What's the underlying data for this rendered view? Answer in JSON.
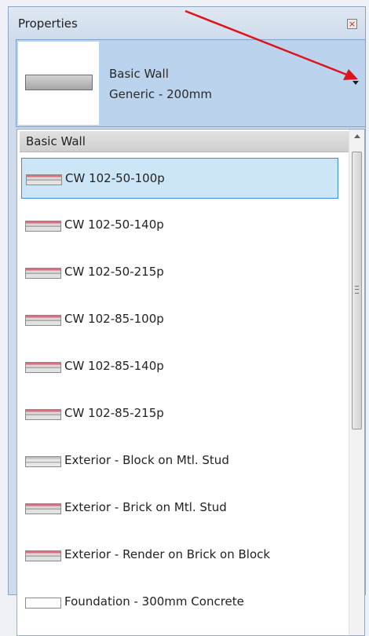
{
  "panel": {
    "title": "Properties"
  },
  "type_selector": {
    "family": "Basic Wall",
    "type": "Generic - 200mm"
  },
  "list": {
    "group_header": "Basic Wall",
    "items": [
      {
        "label": "CW 102-50-100p",
        "swatch": "red",
        "selected": true
      },
      {
        "label": "CW 102-50-140p",
        "swatch": "red",
        "selected": false
      },
      {
        "label": "CW 102-50-215p",
        "swatch": "red",
        "selected": false
      },
      {
        "label": "CW 102-85-100p",
        "swatch": "red",
        "selected": false
      },
      {
        "label": "CW 102-85-140p",
        "swatch": "red",
        "selected": false
      },
      {
        "label": "CW 102-85-215p",
        "swatch": "red",
        "selected": false
      },
      {
        "label": "Exterior - Block on Mtl. Stud",
        "swatch": "gray",
        "selected": false
      },
      {
        "label": "Exterior - Brick on Mtl. Stud",
        "swatch": "red",
        "selected": false
      },
      {
        "label": "Exterior - Render on Brick on Block",
        "swatch": "red",
        "selected": false
      },
      {
        "label": "Foundation - 300mm Concrete",
        "swatch": "white",
        "selected": false
      }
    ]
  },
  "annotation": {
    "arrow_color": "#e0131b"
  }
}
